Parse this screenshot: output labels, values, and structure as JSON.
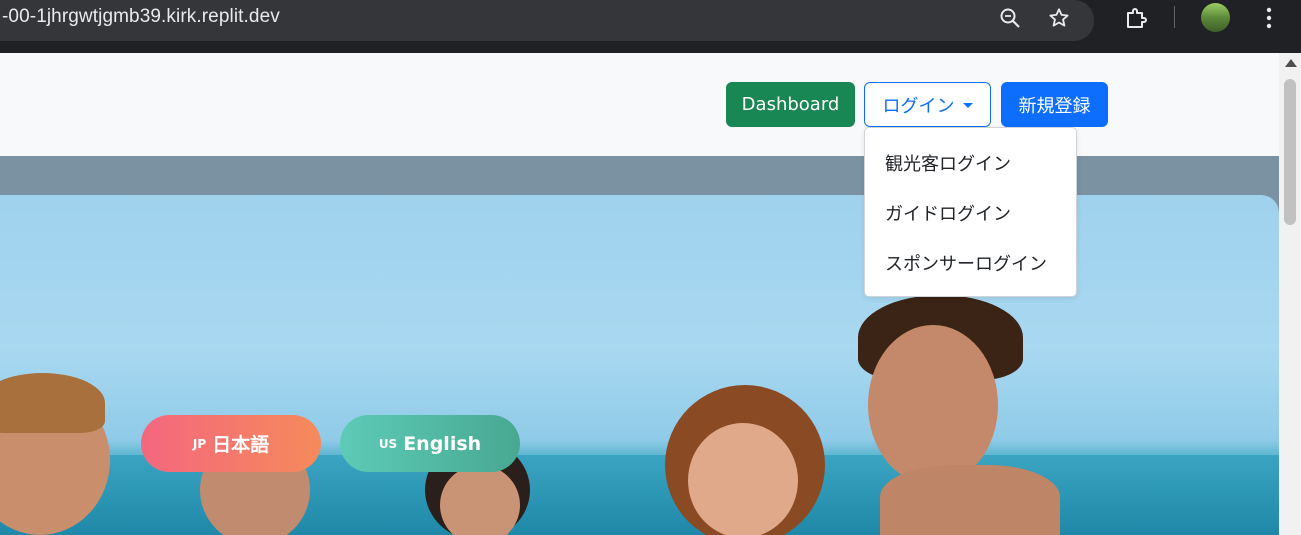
{
  "browser": {
    "url": "-00-1jhrgwtjgmb39.kirk.replit.dev",
    "icons": [
      "zoom-icon",
      "bookmark-star-icon",
      "extensions-icon",
      "profile-avatar",
      "menu-kebab-icon"
    ]
  },
  "navbar": {
    "dashboard_label": "Dashboard",
    "login_label": "ログイン",
    "register_label": "新規登録"
  },
  "login_dropdown": {
    "items": [
      "観光客ログイン",
      "ガイドログイン",
      "スポンサーログイン"
    ]
  },
  "language": {
    "jp_code": "JP",
    "jp_label": "日本語",
    "en_code": "US",
    "en_label": "English"
  },
  "colors": {
    "dashboard": "#198754",
    "primary": "#0d6efd",
    "jp_gradient": "#f4677f",
    "en_gradient": "#5dcbb7"
  }
}
